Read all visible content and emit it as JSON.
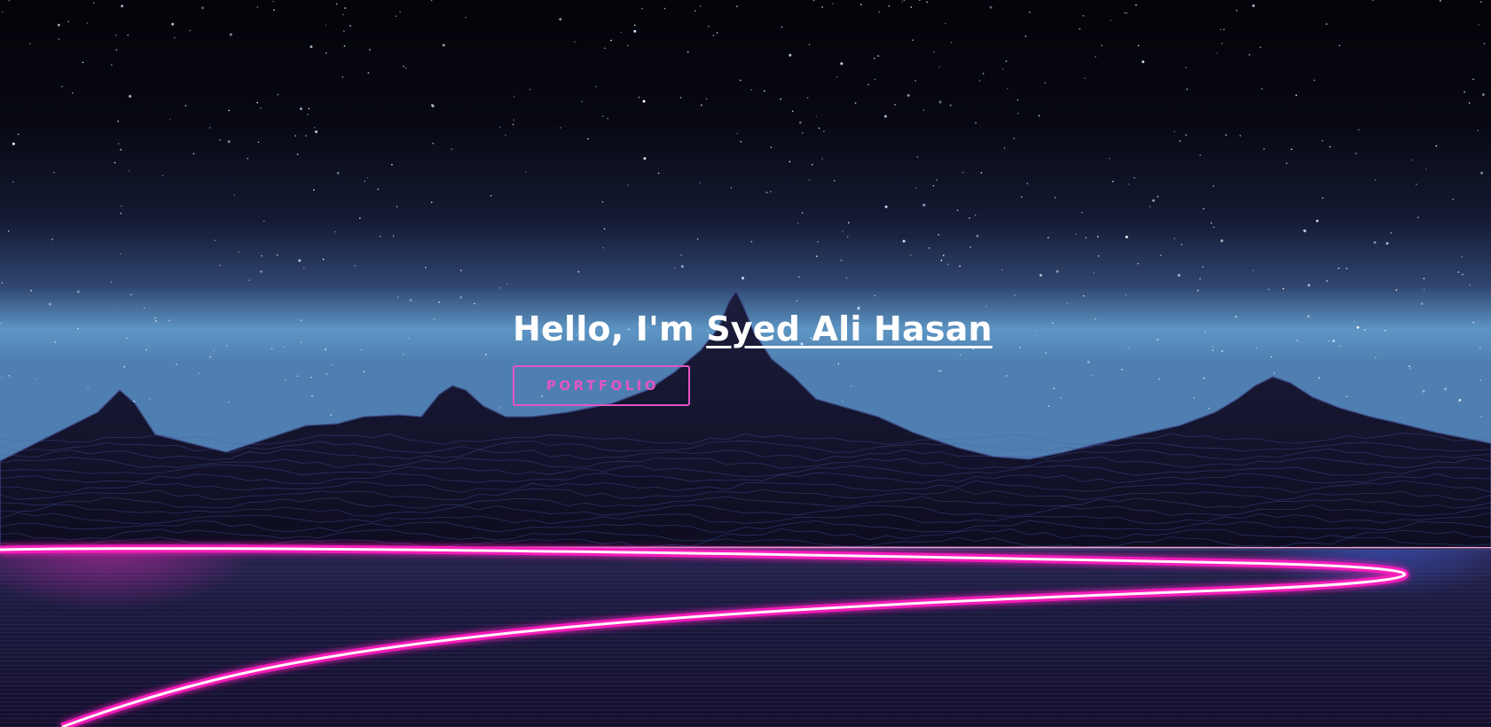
{
  "hero": {
    "greeting": "Hello, I'm",
    "name": "Syed Ali Hasan",
    "button_label": "PORTFOLIO"
  },
  "colors": {
    "accent_pink": "#e255c4",
    "neon_pink": "#ff2bc8",
    "neon_blue": "#3ea8ff",
    "sky_top": "#05040a",
    "sky_horizon": "#5d95c4",
    "mountain": "#14142e",
    "ground": "#1b1838"
  },
  "background": {
    "scene": "synthwave night sky with stars, wireframe mountains and neon light trail"
  }
}
